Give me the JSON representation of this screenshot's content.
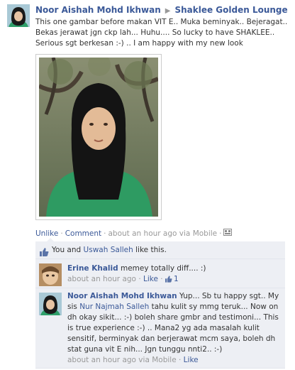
{
  "post": {
    "author": "Noor Aishah Mohd Ikhwan",
    "target": "Shaklee Golden Lounge",
    "text": "This one gambar before makan VIT E.. Muka beminyak.. Bejeragat.. Bekas jerawat jgn ckp lah... Huhu.... So lucky to have SHAKLEE.. Serious sgt berkesan :-) .. I am happy with my new look",
    "actions": {
      "unlike": "Unlike",
      "comment": "Comment",
      "time": "about an hour ago via Mobile"
    },
    "likes": {
      "prefix": "You and",
      "person": "Uswah Salleh",
      "suffix": "like this."
    }
  },
  "comments": [
    {
      "author": "Erine Khalid",
      "text": "memey totally diff.... :)",
      "time": "about an hour ago",
      "like": "Like",
      "like_count": "1"
    },
    {
      "author": "Noor Aishah Mohd Ikhwan",
      "text_before": "Yup... Sb tu happy sgt.. My sis",
      "tag": "Nur Najmah Salleh",
      "text_after": "tahu kulit sy mmg teruk... Now on dh okay sikit... :-) boleh share gmbr and testimoni... This is true experience :-) .. Mana2 yg ada masalah kulit sensitif, berminyak dan berjerawat mcm saya, boleh dh stat guna vit E nih... Jgn tunggu nnti2.. :-)",
      "time": "about an hour ago via Mobile",
      "like": "Like"
    }
  ],
  "colors": {
    "link": "#3b5998",
    "comment_bg": "#edeff4",
    "muted": "#999999"
  }
}
